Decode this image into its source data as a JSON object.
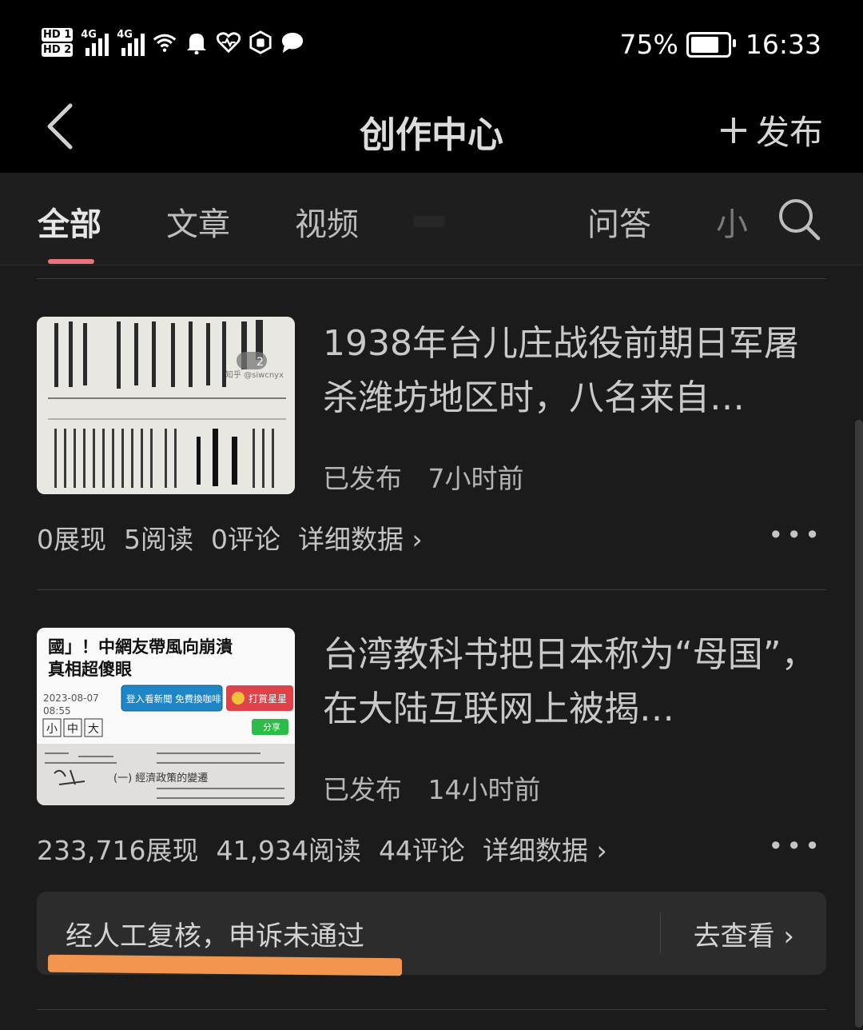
{
  "status_bar": {
    "hd1": "HD 1",
    "hd2": "HD 2",
    "net1": "4G",
    "net2": "4G",
    "battery": "75%",
    "time": "16:33",
    "battery_level": 0.75
  },
  "header": {
    "title": "创作中心",
    "publish_label": "发布"
  },
  "tabs": [
    {
      "label": "全部",
      "active": true
    },
    {
      "label": "文章"
    },
    {
      "label": "视频"
    },
    {
      "label": "问答"
    },
    {
      "label": "小"
    }
  ],
  "items": [
    {
      "title": "1938年台儿庄战役前期日军屠杀潍坊地区时，八名来自…",
      "status": "已发布",
      "time": "7小时前",
      "stats": {
        "impressions": "0展现",
        "reads": "5阅读",
        "comments": "0评论",
        "details": "详细数据"
      },
      "thumb": {
        "likes": "2",
        "watermark": "知乎 @siwcnyx"
      }
    },
    {
      "title": "台湾教科书把日本称为“母国”，在大陆互联网上被揭…",
      "status": "已发布",
      "time": "14小时前",
      "stats": {
        "impressions": "233,716展现",
        "reads": "41,934阅读",
        "comments": "44评论",
        "details": "详细数据"
      },
      "thumb": {
        "headline1": "國」！中網友帶風向崩潰",
        "headline2": "真相超傻眼",
        "date": "2023-08-07",
        "clock": "08:55",
        "size_small": "小",
        "size_mid": "中",
        "size_big": "大",
        "login_btn": "登入看新聞 免費換咖啡",
        "reward_btn": "打賞星星",
        "share_btn": "分享",
        "section": "(一) 經濟政策的變遷"
      },
      "notice": {
        "text": "经人工复核，申诉未通过",
        "action": "去查看"
      }
    }
  ],
  "colors": {
    "accent": "#e8747c",
    "highlight": "#f2954f",
    "bg": "#1b1b1b"
  }
}
